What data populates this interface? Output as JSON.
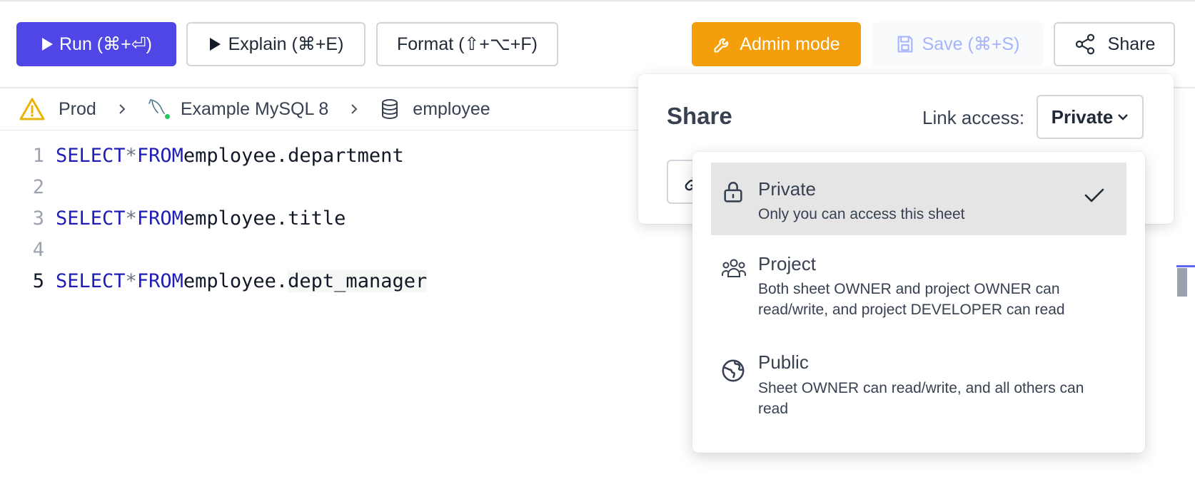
{
  "toolbar": {
    "run_label": "Run (⌘+⏎)",
    "explain_label": "Explain (⌘+E)",
    "format_label": "Format (⇧+⌥+F)",
    "admin_label": "Admin mode",
    "save_label": "Save (⌘+S)",
    "share_label": "Share"
  },
  "breadcrumb": {
    "environment": "Prod",
    "instance": "Example MySQL 8",
    "database": "employee"
  },
  "editor": {
    "lines": [
      {
        "number": "1",
        "keyword1": "SELECT",
        "op": "*",
        "keyword2": "FROM",
        "table": "employee.department"
      },
      {
        "number": "2"
      },
      {
        "number": "3",
        "keyword1": "SELECT",
        "op": "*",
        "keyword2": "FROM",
        "table": "employee.title"
      },
      {
        "number": "4"
      },
      {
        "number": "5",
        "keyword1": "SELECT",
        "op": "*",
        "keyword2": "FROM",
        "table_prefix": "employee.",
        "table_highlight": "dept_manager"
      }
    ]
  },
  "share_panel": {
    "title": "Share",
    "link_access_label": "Link access:",
    "selected_access": "Private"
  },
  "access_options": [
    {
      "title": "Private",
      "description": "Only you can access this sheet",
      "selected": true
    },
    {
      "title": "Project",
      "description_line1": "Both sheet OWNER and project OWNER can",
      "description_line2": "read/write, and project DEVELOPER can read",
      "selected": false
    },
    {
      "title": "Public",
      "description_line1": "Sheet OWNER can read/write, and all others can",
      "description_line2": "read",
      "selected": false
    }
  ],
  "colors": {
    "run_button": "#4f46e5",
    "admin_button": "#f59e0b",
    "save_text": "#a5b4fc",
    "sql_keyword": "#1d1db8",
    "warning": "#eab308",
    "connection_dot": "#22c55e"
  },
  "icons": [
    "play-icon",
    "wrench-icon",
    "save-icon",
    "share-icon",
    "warning-icon",
    "mysql-dolphin-icon",
    "database-icon",
    "chevron-right-icon",
    "chevron-down-icon",
    "lock-icon",
    "users-icon",
    "globe-icon",
    "check-icon",
    "link-icon"
  ]
}
